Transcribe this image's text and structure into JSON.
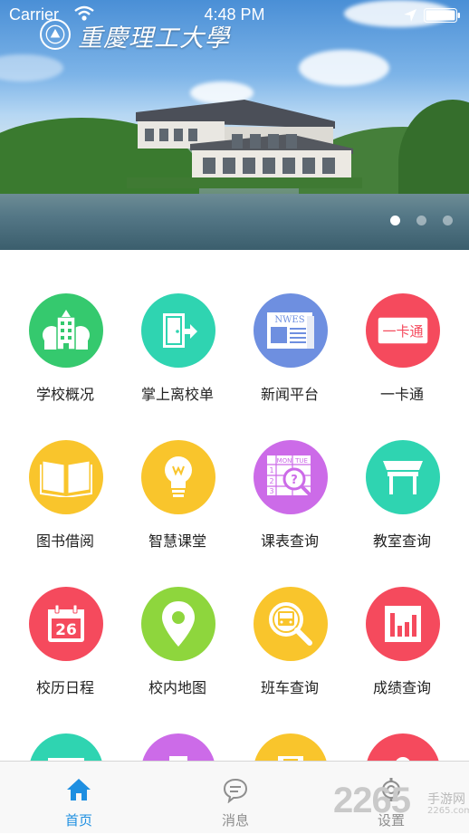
{
  "status_bar": {
    "carrier": "Carrier",
    "time": "4:48 PM"
  },
  "banner": {
    "school_name": "重慶理工大學",
    "slide_count": 3,
    "active_slide": 1
  },
  "grid": [
    {
      "label": "学校概况",
      "icon": "school-building-icon",
      "color": "#35c96e"
    },
    {
      "label": "掌上离校单",
      "icon": "door-exit-icon",
      "color": "#2fd4b1"
    },
    {
      "label": "新闻平台",
      "icon": "newspaper-icon",
      "color": "#6e8fe0",
      "badge": "NWES"
    },
    {
      "label": "一卡通",
      "icon": "card-icon",
      "color": "#f54a5d",
      "badge": "一卡通"
    },
    {
      "label": "图书借阅",
      "icon": "open-book-icon",
      "color": "#f9c52c"
    },
    {
      "label": "智慧课堂",
      "icon": "lightbulb-icon",
      "color": "#f9c52c"
    },
    {
      "label": "课表查询",
      "icon": "timetable-icon",
      "color": "#cc6be8",
      "badge_cols": [
        "MON",
        "TUE"
      ],
      "badge_rows": [
        "1",
        "2",
        "3"
      ]
    },
    {
      "label": "教室查询",
      "icon": "classroom-desk-icon",
      "color": "#2fd4b1"
    },
    {
      "label": "校历日程",
      "icon": "calendar-icon",
      "color": "#f54a5d",
      "badge": "26"
    },
    {
      "label": "校内地图",
      "icon": "map-pin-icon",
      "color": "#8ed63d"
    },
    {
      "label": "班车查询",
      "icon": "bus-search-icon",
      "color": "#f9c52c"
    },
    {
      "label": "成绩查询",
      "icon": "bar-chart-icon",
      "color": "#f54a5d"
    },
    {
      "label": "",
      "icon": "id-card-icon",
      "color": "#2fd4b1"
    },
    {
      "label": "",
      "icon": "camera-icon",
      "color": "#cc6be8"
    },
    {
      "label": "",
      "icon": "vote-box-icon",
      "color": "#f9c52c"
    },
    {
      "label": "",
      "icon": "person-icon",
      "color": "#f54a5d"
    }
  ],
  "tabs": [
    {
      "label": "首页",
      "icon": "home-icon",
      "active": true
    },
    {
      "label": "消息",
      "icon": "chat-bubble-icon",
      "active": false
    },
    {
      "label": "设置",
      "icon": "gear-icon",
      "active": false
    }
  ],
  "watermark": {
    "text": "2265",
    "suffix": "手游网",
    "site": "2265.com"
  },
  "colors": {
    "accent": "#1e8fe1",
    "tab_inactive": "#8e8e8e"
  }
}
